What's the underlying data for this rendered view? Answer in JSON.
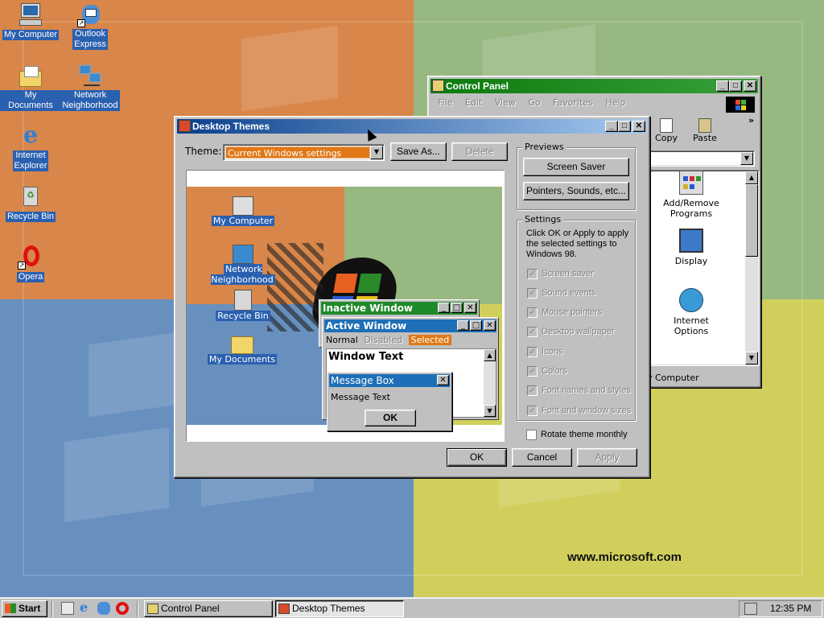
{
  "desktop": {
    "icons": [
      {
        "label": "My Computer",
        "icon": "my-computer-icon"
      },
      {
        "label": "Outlook\nExpress",
        "label_lines": [
          "Outlook",
          "Express"
        ],
        "icon": "outlook-express-icon"
      },
      {
        "label": "My Documents",
        "icon": "my-documents-icon"
      },
      {
        "label_lines": [
          "Network",
          "Neighborhood"
        ],
        "icon": "network-neighborhood-icon"
      },
      {
        "label_lines": [
          "Internet",
          "Explorer"
        ],
        "icon": "internet-explorer-icon"
      },
      {
        "label": "Recycle Bin",
        "icon": "recycle-bin-icon"
      },
      {
        "label": "Opera",
        "icon": "opera-icon"
      }
    ],
    "watermark": "www.microsoft.com"
  },
  "control_panel": {
    "title": "Control Panel",
    "menu": [
      "File",
      "Edit",
      "View",
      "Go",
      "Favorites",
      "Help"
    ],
    "toolbar": {
      "copy": "Copy",
      "paste": "Paste",
      "more": "»"
    },
    "items": [
      {
        "label_lines": [
          "Add/Remove",
          "Programs"
        ],
        "icon": "add-remove-programs-icon"
      },
      {
        "label": "Display",
        "icon": "display-icon"
      },
      {
        "label_lines": [
          "Internet",
          "Options"
        ],
        "icon": "internet-options-icon"
      }
    ],
    "status": "y Computer"
  },
  "themes": {
    "title": "Desktop Themes",
    "theme_label": "Theme:",
    "theme_value": "Current Windows settings",
    "save_as": "Save As...",
    "delete": "Delete",
    "preview": {
      "icons": [
        "My Computer",
        "Network Neighborhood",
        "Recycle Bin",
        "My Documents"
      ],
      "inactive_title": "Inactive Window",
      "active_title": "Active Window",
      "menu_normal": "Normal",
      "menu_disabled": "Disabled",
      "menu_selected": "Selected",
      "window_text": "Window Text",
      "msg_title": "Message Box",
      "msg_text": "Message Text",
      "msg_ok": "OK"
    },
    "previews_label": "Previews",
    "screen_saver": "Screen Saver",
    "pointers": "Pointers, Sounds, etc...",
    "settings_label": "Settings",
    "settings_text": "Click OK or Apply to apply the selected settings to Windows 98.",
    "settings_items": [
      "Screen saver",
      "Sound events",
      "Mouse pointers",
      "Desktop wallpaper",
      "Icons",
      "Colors",
      "Font names and styles",
      "Font and window sizes"
    ],
    "rotate": "Rotate theme monthly",
    "ok": "OK",
    "cancel": "Cancel",
    "apply": "Apply",
    "colors": {
      "title_active": "#0a3f8c",
      "title_active_end": "#a6caf0",
      "selected_field": "#e07818"
    }
  },
  "taskbar": {
    "start": "Start",
    "tasks": [
      "Control Panel",
      "Desktop Themes"
    ],
    "time": "12:35 PM"
  }
}
